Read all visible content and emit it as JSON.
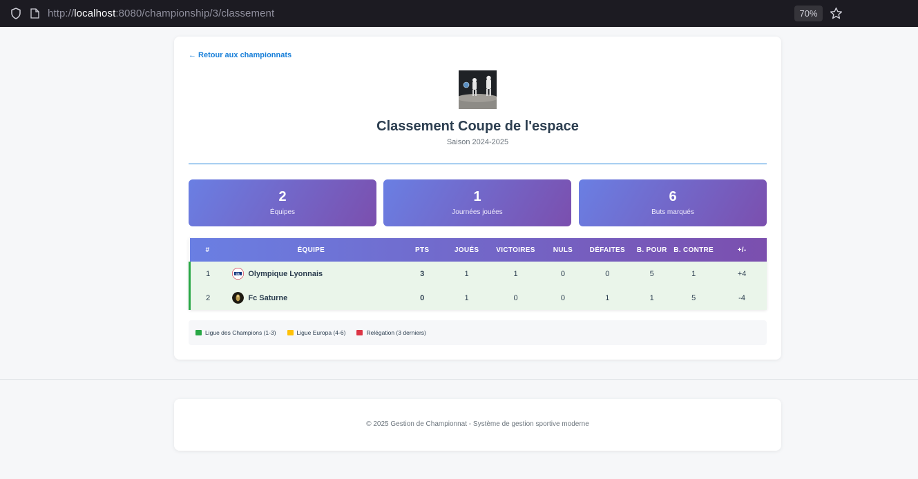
{
  "browser": {
    "url_prefix": "http://",
    "url_host": "localhost",
    "url_path": ":8080/championship/3/classement",
    "zoom": "70%"
  },
  "page": {
    "back_link": "← Retour aux championnats",
    "title": "Classement Coupe de l'espace",
    "season": "Saison 2024-2025"
  },
  "stats": [
    {
      "value": "2",
      "label": "Équipes"
    },
    {
      "value": "1",
      "label": "Journées jouées"
    },
    {
      "value": "6",
      "label": "Buts marqués"
    }
  ],
  "table": {
    "headers": [
      "#",
      "ÉQUIPE",
      "PTS",
      "JOUÉS",
      "VICTOIRES",
      "NULS",
      "DÉFAITES",
      "B. POUR",
      "B. CONTRE",
      "+/-"
    ],
    "rows": [
      {
        "rank": "1",
        "team": "Olympique Lyonnais",
        "pts": "3",
        "played": "1",
        "wins": "1",
        "draws": "0",
        "losses": "0",
        "gf": "5",
        "ga": "1",
        "diff": "+4"
      },
      {
        "rank": "2",
        "team": "Fc Saturne",
        "pts": "0",
        "played": "1",
        "wins": "0",
        "draws": "0",
        "losses": "1",
        "gf": "1",
        "ga": "5",
        "diff": "-4"
      }
    ]
  },
  "legend": [
    {
      "label": "Ligue des Champions (1-3)",
      "color": "#28a745"
    },
    {
      "label": "Ligue Europa (4-6)",
      "color": "#ffc107"
    },
    {
      "label": "Relégation (3 derniers)",
      "color": "#dc3545"
    }
  ],
  "footer": {
    "text": "© 2025 Gestion de Championnat - Système de gestion sportive moderne"
  },
  "colors": {
    "accent": "#1a80d9",
    "gradient_start": "#6a7fe3",
    "gradient_end": "#7b4fae"
  }
}
